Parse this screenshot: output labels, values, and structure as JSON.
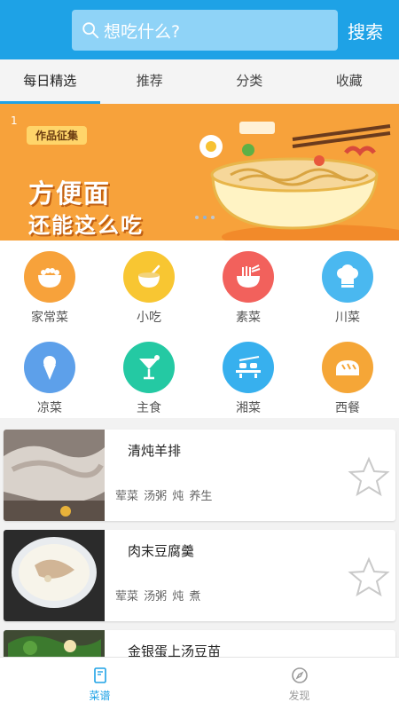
{
  "header": {
    "search_placeholder": "想吃什么?",
    "search_button": "搜索",
    "accent_color": "#1ea2e6"
  },
  "tabs": [
    {
      "label": "每日精选",
      "active": true
    },
    {
      "label": "推荐",
      "active": false
    },
    {
      "label": "分类",
      "active": false
    },
    {
      "label": "收藏",
      "active": false
    }
  ],
  "banner": {
    "index": "1",
    "tag": "作品征集",
    "line1": "方便面",
    "line2": "还能这么吃",
    "slides_total": 3,
    "current_slide": 2
  },
  "categories": [
    {
      "label": "家常菜",
      "icon": "rice-bowl-icon",
      "color": "#f7a23b"
    },
    {
      "label": "小吃",
      "icon": "snack-bowl-icon",
      "color": "#f8c632"
    },
    {
      "label": "素菜",
      "icon": "noodle-bowl-icon",
      "color": "#f2615c"
    },
    {
      "label": "川菜",
      "icon": "chef-hat-icon",
      "color": "#4ab8f0"
    },
    {
      "label": "凉菜",
      "icon": "ice-cream-icon",
      "color": "#5da0ea"
    },
    {
      "label": "主食",
      "icon": "cocktail-icon",
      "color": "#24c9a3"
    },
    {
      "label": "湘菜",
      "icon": "sushi-plate-icon",
      "color": "#37b0ee"
    },
    {
      "label": "西餐",
      "icon": "bread-icon",
      "color": "#f5a637"
    }
  ],
  "recipes": [
    {
      "title": "清炖羊排",
      "tags": "荤菜 汤粥 炖 养生"
    },
    {
      "title": "肉末豆腐羹",
      "tags": "荤菜 汤粥 炖 煮"
    },
    {
      "title": "金银蛋上汤豆苗",
      "tags": ""
    }
  ],
  "bottom_nav": [
    {
      "label": "菜谱",
      "icon": "recipe-book-icon",
      "active": true
    },
    {
      "label": "发现",
      "icon": "compass-icon",
      "active": false
    }
  ]
}
